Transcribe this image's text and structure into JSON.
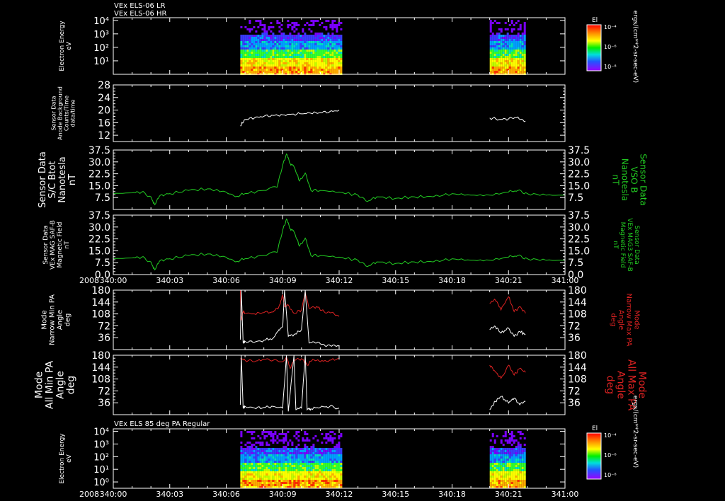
{
  "header": {
    "line1": "VEx ELS-06 LR",
    "line2": "VEx ELS-06 HR",
    "bottom_title": "VEx ELS 85 deg PA Regular"
  },
  "units_label": "ergs/(cm**2-sr-sec-eV)",
  "colorbar": {
    "title": "El",
    "ticks": [
      "10⁻⁴",
      "10⁻⁶",
      "10⁻⁸"
    ]
  },
  "year_label": "2008",
  "colors": {
    "white": "#ffffff",
    "green": "#22cc22",
    "red": "#dd2222",
    "axis": "#ffffff"
  },
  "chart_data": [
    {
      "type": "heatmap",
      "ylabel": [
        "Electron Energy",
        "eV"
      ],
      "yticks": [
        "10⁴",
        "10³",
        "10²",
        "10¹"
      ],
      "ylim_log10": [
        0,
        4.2
      ],
      "x_intervals": [
        [
          "340:06.75",
          "340:12.1"
        ],
        [
          "340:20.0",
          "340:21.9"
        ]
      ]
    },
    {
      "type": "line",
      "ylabel": [
        "Sensor Data",
        "Anode Background",
        "Counts/Time",
        "data/time"
      ],
      "ylim": [
        10,
        28
      ],
      "yticks": [
        12,
        16,
        20,
        24,
        28
      ],
      "ytick_labels": [
        "12",
        "16",
        "20",
        "24",
        "28"
      ],
      "series": [
        {
          "color": "white",
          "segments": [
            {
              "x": [
                6.75,
                7.0,
                7.5,
                8.0,
                8.5,
                9.0,
                9.5,
                10.0,
                10.5,
                11.0,
                11.5,
                12.0
              ],
              "y": [
                15,
                17,
                17.5,
                18,
                18.3,
                18.5,
                18.7,
                18.8,
                19,
                19.2,
                19.5,
                20
              ]
            },
            {
              "x": [
                20.0,
                20.5,
                21.0,
                21.5,
                21.9
              ],
              "y": [
                17.5,
                17,
                17.2,
                17.8,
                16.5
              ]
            }
          ]
        }
      ]
    },
    {
      "type": "line",
      "ylabel_left": [
        "Sensor Data",
        "S/C Btot",
        "Nanotesla",
        "nT"
      ],
      "ylabel_right": [
        "Sensor Data",
        "VSO B",
        "Nanotesla",
        "nT"
      ],
      "ylim": [
        0,
        37.5
      ],
      "yticks": [
        7.5,
        15,
        22.5,
        30,
        37.5
      ],
      "ytick_labels": [
        "7.5",
        "15.0",
        "22.5",
        "30.0",
        "37.5"
      ],
      "series": [
        {
          "color": "green",
          "x": [
            0,
            1,
            1.5,
            2,
            2.2,
            2.5,
            3,
            4,
            5,
            6,
            6.5,
            7,
            8,
            8.7,
            9,
            9.2,
            9.4,
            9.6,
            9.9,
            10.2,
            10.5,
            11,
            12,
            13,
            13.5,
            14,
            15,
            16,
            17,
            18,
            19,
            20,
            21,
            21.5,
            22,
            23,
            24
          ],
          "y": [
            10,
            10.5,
            11,
            8,
            3,
            9,
            10,
            12,
            13,
            11,
            8,
            10,
            12,
            14,
            28,
            35,
            29,
            27,
            18,
            23,
            12,
            12,
            11,
            9,
            5,
            8,
            7,
            8,
            8,
            10,
            9,
            9,
            11,
            12,
            10,
            9,
            9
          ]
        }
      ]
    },
    {
      "type": "line",
      "ylabel_left": [
        "Sensor Data",
        "VEx MAG SAF-B",
        "Magnetic Field",
        "nT"
      ],
      "ylabel_right": [
        "Sensor Data",
        "VEx MAG3 SAF-B",
        "Magnetic Field",
        "nT"
      ],
      "ylim": [
        0,
        37.5
      ],
      "yticks": [
        0,
        7.5,
        15,
        22.5,
        30,
        37.5
      ],
      "ytick_labels": [
        "0.0",
        "7.5",
        "15.0",
        "22.5",
        "30.0",
        "37.5"
      ],
      "xticks": [
        "340:00",
        "340:03",
        "340:06",
        "340:09",
        "340:12",
        "340:15",
        "340:18",
        "340:21",
        "341:00"
      ],
      "series": [
        {
          "color": "green",
          "x": [
            0,
            1,
            1.5,
            2,
            2.2,
            2.5,
            3,
            4,
            5,
            6,
            6.5,
            7,
            8,
            8.7,
            9,
            9.2,
            9.4,
            9.6,
            9.9,
            10.2,
            10.5,
            11,
            12,
            13,
            13.5,
            14,
            15,
            16,
            17,
            18,
            19,
            20,
            21,
            21.5,
            22,
            23,
            24
          ],
          "y": [
            10,
            10.5,
            11,
            8,
            3,
            9,
            10,
            12,
            13,
            11,
            8,
            10,
            12,
            14,
            28,
            35,
            29,
            27,
            18,
            23,
            12,
            12,
            11,
            9,
            5,
            8,
            7,
            8,
            8,
            10,
            9,
            9,
            11,
            12,
            10,
            9,
            9
          ]
        }
      ]
    },
    {
      "type": "line",
      "ylabel_left": [
        "Mode",
        "Narrow Min PA",
        "Angle",
        "deg"
      ],
      "ylabel_right": [
        "Mode",
        "Narrow Max PA",
        "Angle",
        "deg"
      ],
      "ylim": [
        0,
        180
      ],
      "yticks": [
        36,
        72,
        108,
        144,
        180
      ],
      "ytick_labels": [
        "36",
        "72",
        "108",
        "144",
        "180"
      ],
      "series": [
        {
          "color": "red",
          "segments": [
            {
              "x": [
                6.75,
                6.8,
                6.9,
                7.0,
                7.5,
                8.0,
                8.5,
                8.8,
                9.0,
                9.1,
                9.3,
                9.6,
                10.0,
                10.2,
                10.4,
                10.8,
                11.2,
                11.6,
                12.0
              ],
              "y": [
                180,
                90,
                115,
                110,
                108,
                112,
                114,
                130,
                165,
                130,
                135,
                110,
                120,
                175,
                125,
                130,
                115,
                112,
                100
              ]
            },
            {
              "x": [
                20.0,
                20.3,
                20.6,
                21.0,
                21.3,
                21.6,
                21.9
              ],
              "y": [
                140,
                150,
                120,
                160,
                115,
                130,
                110
              ]
            }
          ]
        },
        {
          "color": "white",
          "segments": [
            {
              "x": [
                6.75,
                6.8,
                6.9,
                7.0,
                7.5,
                8.0,
                8.5,
                8.8,
                9.0,
                9.1,
                9.3,
                9.6,
                10.0,
                10.2,
                10.4,
                10.8,
                11.2,
                11.6,
                12.0
              ],
              "y": [
                30,
                180,
                20,
                25,
                22,
                28,
                35,
                60,
                70,
                180,
                40,
                45,
                60,
                180,
                20,
                20,
                15,
                10,
                10
              ]
            },
            {
              "x": [
                20.0,
                20.3,
                20.6,
                21.0,
                21.3,
                21.6,
                21.9
              ],
              "y": [
                60,
                70,
                50,
                65,
                40,
                55,
                45
              ]
            }
          ]
        }
      ]
    },
    {
      "type": "line",
      "ylabel_left": [
        "Mode",
        "All Min PA",
        "Angle",
        "deg"
      ],
      "ylabel_right": [
        "Mode",
        "All Max PA",
        "Angle",
        "deg"
      ],
      "ylim": [
        0,
        180
      ],
      "yticks": [
        36,
        72,
        108,
        144,
        180
      ],
      "ytick_labels": [
        "36",
        "72",
        "108",
        "144",
        "180"
      ],
      "series": [
        {
          "color": "red",
          "segments": [
            {
              "x": [
                6.75,
                7.0,
                7.5,
                8.0,
                8.5,
                9.0,
                9.2,
                9.4,
                9.6,
                10.0,
                10.3,
                10.6,
                11.0,
                11.5,
                12.0
              ],
              "y": [
                170,
                165,
                160,
                168,
                165,
                160,
                175,
                140,
                165,
                170,
                150,
                168,
                160,
                165,
                170
              ]
            },
            {
              "x": [
                20.0,
                20.3,
                20.6,
                21.0,
                21.3,
                21.6,
                21.9
              ],
              "y": [
                150,
                130,
                110,
                150,
                120,
                140,
                128
              ]
            }
          ]
        },
        {
          "color": "white",
          "segments": [
            {
              "x": [
                6.75,
                6.8,
                6.9,
                7.0,
                7.5,
                8.0,
                8.5,
                9.0,
                9.2,
                9.3,
                9.6,
                9.7,
                10.0,
                10.2,
                10.3,
                10.5,
                11.0,
                11.5,
                12.0
              ],
              "y": [
                30,
                180,
                20,
                25,
                20,
                22,
                25,
                20,
                180,
                10,
                180,
                15,
                20,
                180,
                15,
                18,
                22,
                25,
                20
              ]
            },
            {
              "x": [
                20.0,
                20.3,
                20.6,
                21.0,
                21.3,
                21.6,
                21.9
              ],
              "y": [
                15,
                40,
                55,
                35,
                50,
                30,
                40
              ]
            }
          ]
        }
      ]
    },
    {
      "type": "heatmap",
      "ylabel": [
        "Electron Energy",
        "eV"
      ],
      "yticks": [
        "10⁴",
        "10³",
        "10²",
        "10¹",
        "10⁰"
      ],
      "ylim_log10": [
        -0.5,
        4.2
      ],
      "xticks": [
        "340:00",
        "340:03",
        "340:06",
        "340:09",
        "340:12",
        "340:15",
        "340:18",
        "340:21",
        "341:00"
      ],
      "x_intervals": [
        [
          "340:06.75",
          "340:12.1"
        ],
        [
          "340:20.0",
          "340:21.9"
        ]
      ]
    }
  ]
}
